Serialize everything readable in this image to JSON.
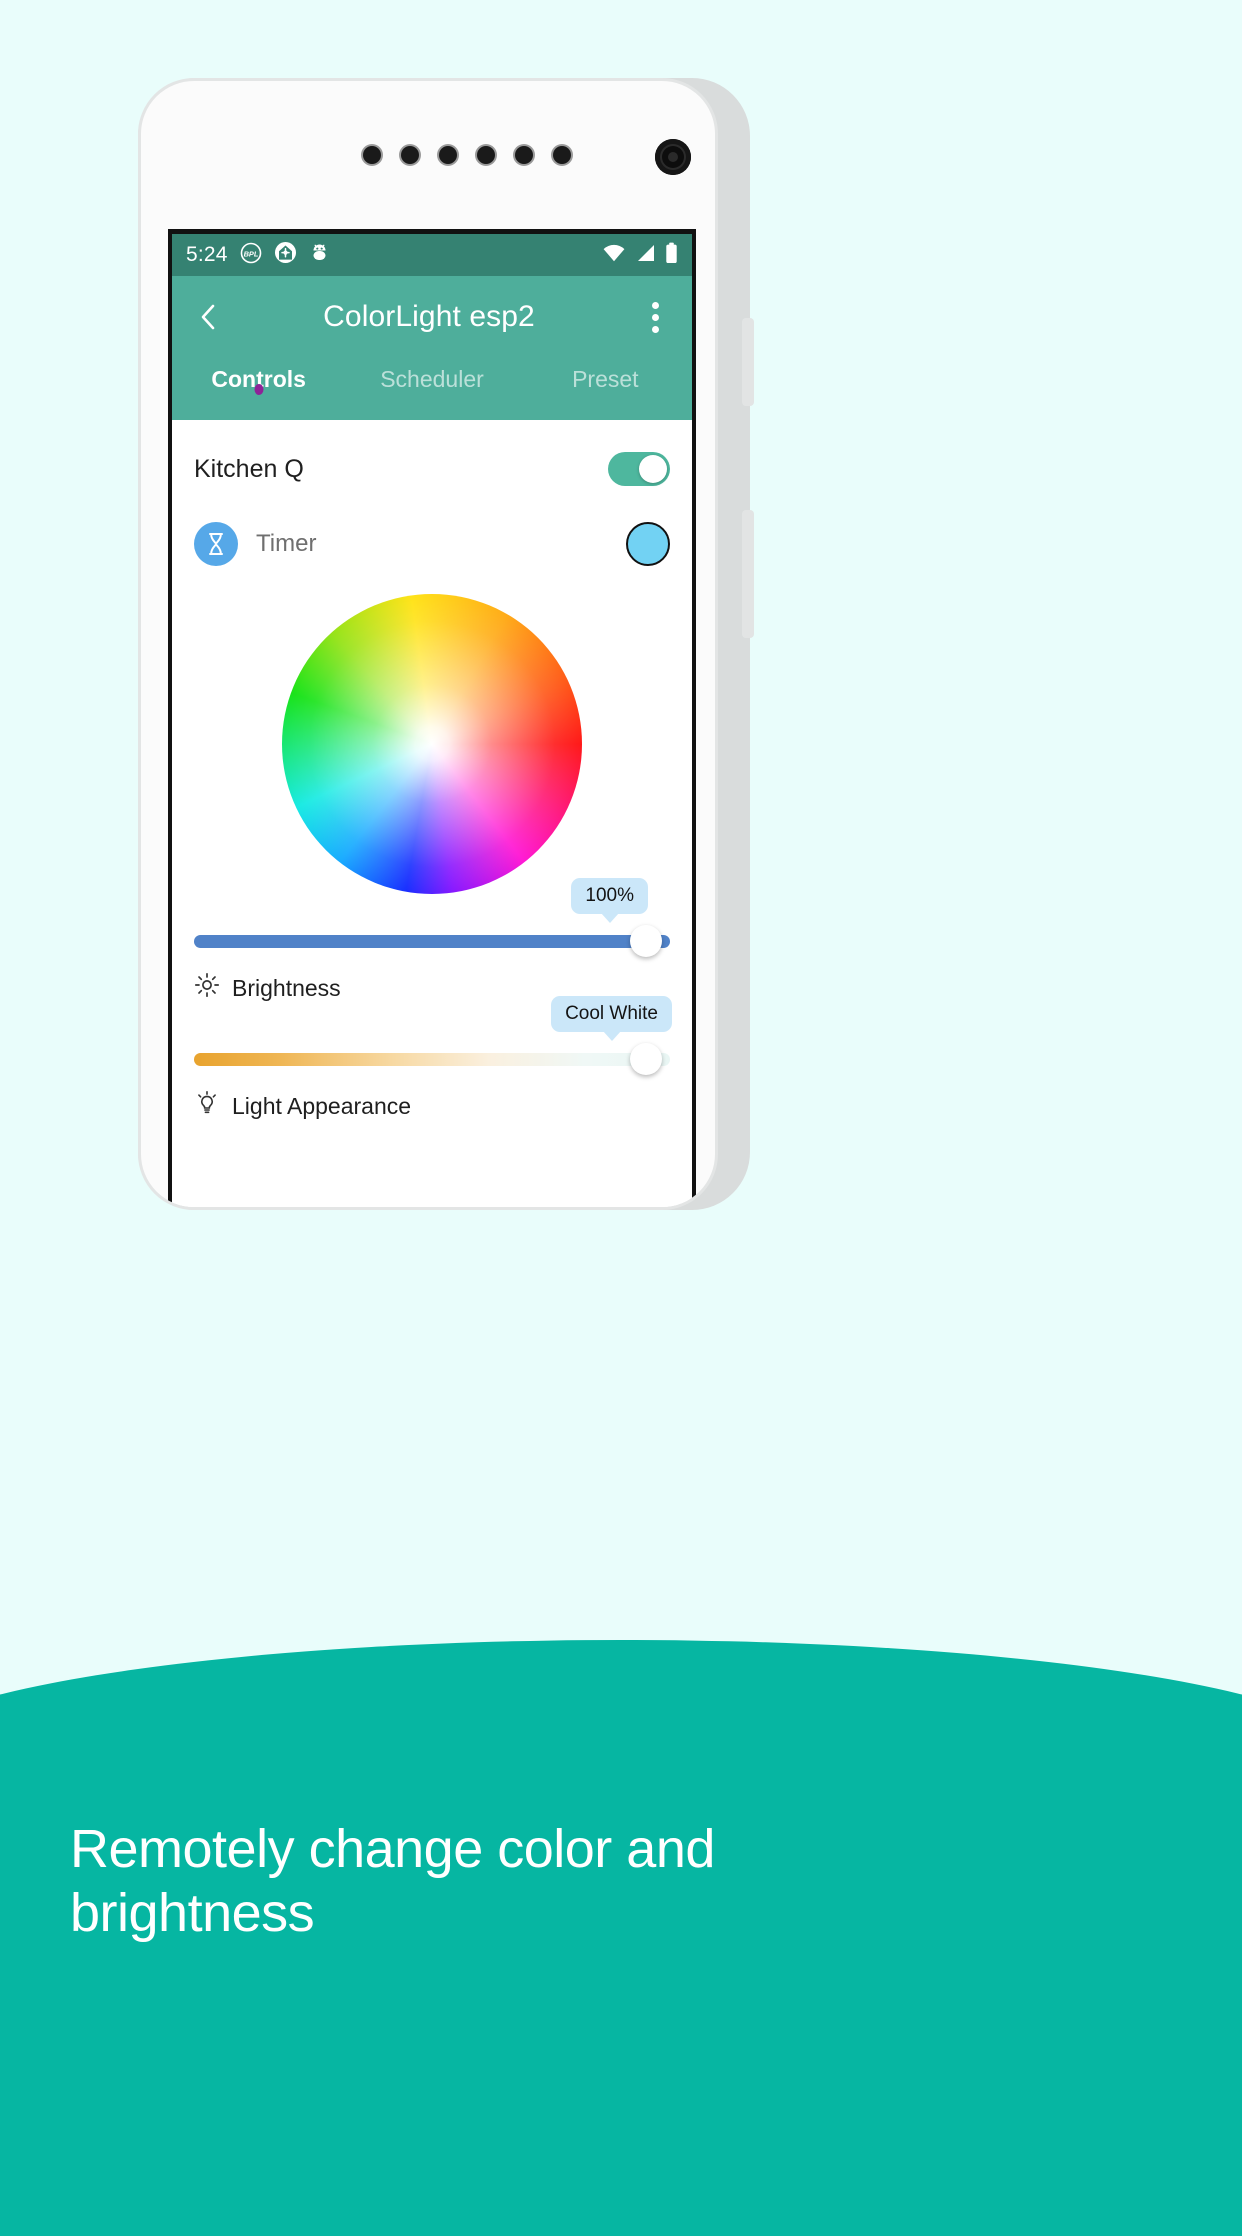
{
  "promo": {
    "caption": "Remotely change color and brightness",
    "background_color": "#06b6a2"
  },
  "page": {
    "background_color": "#e9fdfb"
  },
  "phone": {
    "speaker_dot_count": 6,
    "camera_icon": "camera-lens-icon"
  },
  "statusbar": {
    "time": "5:24",
    "background_color": "#358272",
    "left_icons": [
      {
        "name": "bpl-carrier-icon",
        "label": "BPL"
      },
      {
        "name": "home-app-icon",
        "label": ""
      },
      {
        "name": "android-robot-icon",
        "label": ""
      }
    ],
    "right_icons": [
      {
        "name": "wifi-icon"
      },
      {
        "name": "cellular-signal-icon"
      },
      {
        "name": "battery-icon"
      }
    ]
  },
  "appbar": {
    "title": "ColorLight esp2",
    "background_color": "#4eae9b",
    "back_icon": "back-chevron-icon",
    "overflow_icon": "overflow-menu-icon"
  },
  "tabs": {
    "items": [
      {
        "label": "Controls",
        "active": true
      },
      {
        "label": "Scheduler",
        "active": false
      },
      {
        "label": "Preset",
        "active": false
      }
    ],
    "indicator_color": "#8e2398"
  },
  "controls": {
    "device": {
      "name": "Kitchen Q",
      "power_on": true,
      "toggle_color": "#4eb79e"
    },
    "timer": {
      "label": "Timer",
      "icon": "hourglass-icon",
      "icon_background": "#56a8e8",
      "swatch_color": "#72d2f3"
    },
    "color_wheel": {
      "name": "hsv-color-wheel"
    },
    "brightness": {
      "label": "Brightness",
      "icon": "brightness-sun-icon",
      "value_label": "100%",
      "value": 100,
      "min": 0,
      "max": 100,
      "track_color": "#5082c8",
      "tooltip_color": "#cbe7f9"
    },
    "appearance": {
      "label": "Light Appearance",
      "icon": "bulb-icon",
      "value_label": "Cool White",
      "value": 100,
      "min": 0,
      "max": 100,
      "gradient_from": "#e8a32e",
      "gradient_to": "#e9f6f4",
      "tooltip_color": "#cbe7f9"
    }
  }
}
